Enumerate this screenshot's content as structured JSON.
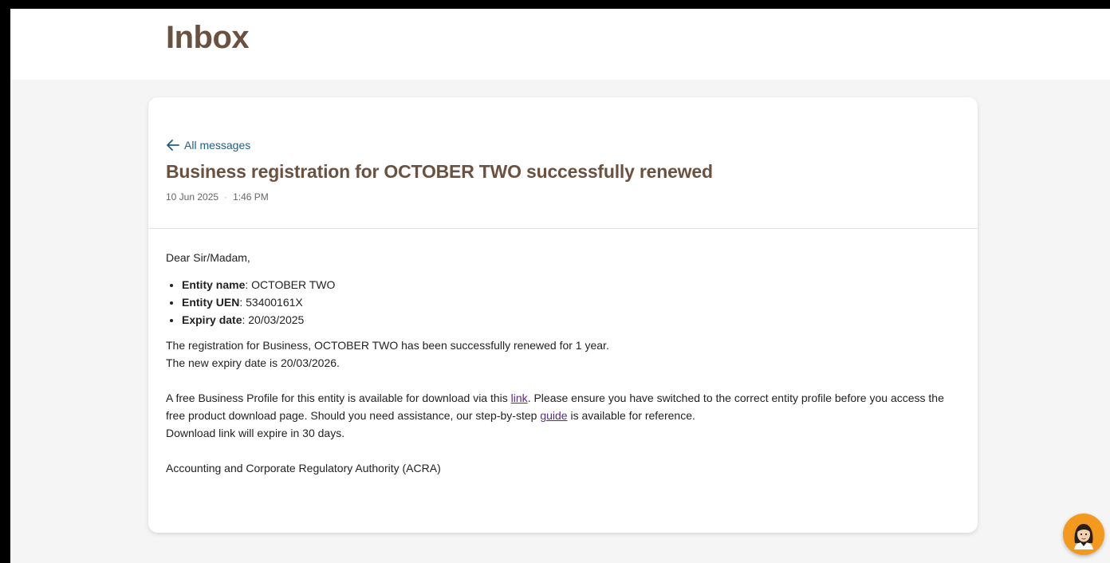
{
  "header": {
    "title": "Inbox"
  },
  "message": {
    "back_label": "All messages",
    "title": "Business registration for OCTOBER TWO successfully renewed",
    "date": "10 Jun 2025",
    "separator": "·",
    "time": "1:46 PM",
    "greeting": "Dear Sir/Madam,",
    "details": [
      {
        "label": "Entity name",
        "value": ": OCTOBER TWO"
      },
      {
        "label": "Entity UEN",
        "value": ": 53400161X"
      },
      {
        "label": "Expiry date",
        "value": ": 20/03/2025"
      }
    ],
    "renewal_line1": "The registration for Business, OCTOBER TWO has been successfully renewed for 1 year.",
    "renewal_line2": "The new expiry date is 20/03/2026.",
    "profile_text_a": "A free Business Profile for this entity is available for download via this ",
    "profile_link": "link",
    "profile_text_b": ". Please ensure you have switched to the correct entity profile before you access the free product download page. Should you need assistance, our step-by-step ",
    "guide_link": "guide",
    "profile_text_c": " is available for reference.",
    "expiry_note": "Download link will expire in 30 days.",
    "signature": "Accounting and Corporate Regulatory Authority (ACRA)"
  },
  "colors": {
    "title_brown": "#6b5240",
    "link_blue": "#1f5e86",
    "link_purple": "#5a2a8a",
    "chat_orange": "#f39a1e"
  },
  "icons": {
    "back": "arrow-left-icon",
    "chat": "assistant-avatar-icon"
  }
}
